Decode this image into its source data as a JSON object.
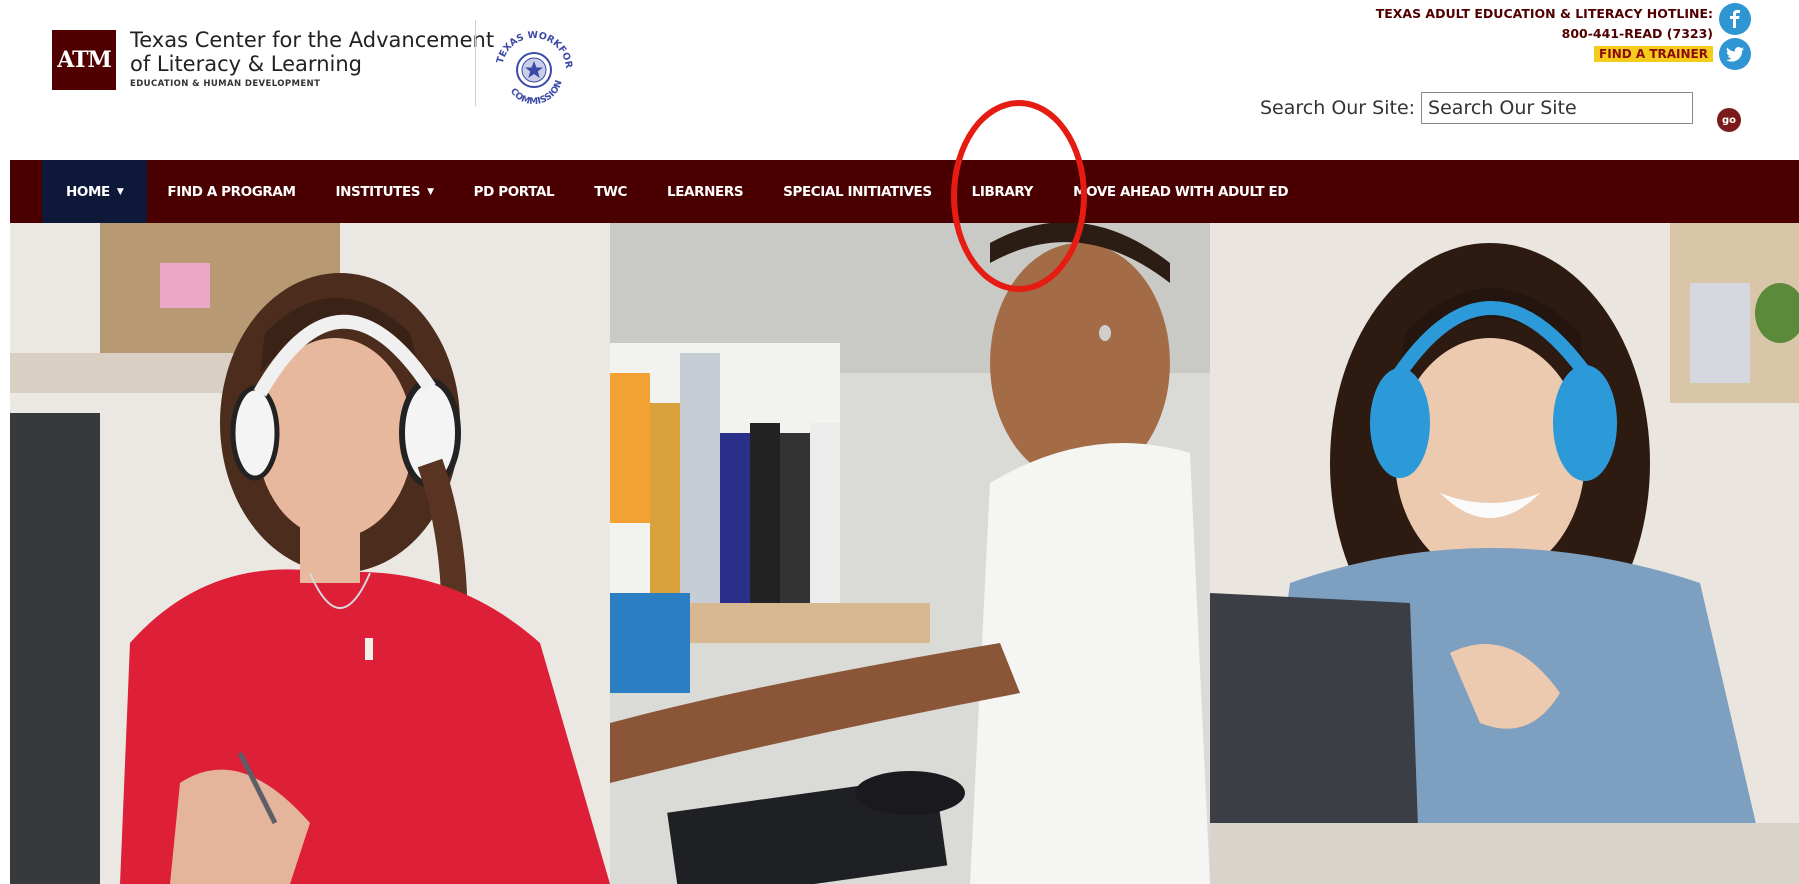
{
  "header": {
    "logo_text": "ATM",
    "brand_line1": "Texas Center for the Advancement",
    "brand_line2": "of Literacy & Learning",
    "brand_sub": "EDUCATION & HUMAN DEVELOPMENT",
    "seal_text": "TEXAS WORKFORCE COMMISSION",
    "hotline_title": "TEXAS ADULT EDUCATION & LITERACY HOTLINE:",
    "hotline_phone": "800-441-READ (7323)",
    "find_trainer": "FIND A TRAINER",
    "social": {
      "facebook_icon": "facebook-icon",
      "twitter_icon": "twitter-icon"
    }
  },
  "search": {
    "label": "Search Our Site:",
    "placeholder": "Search Our Site",
    "go_label": "go"
  },
  "nav": {
    "items": [
      {
        "label": "HOME",
        "has_caret": true,
        "active": true
      },
      {
        "label": "FIND A PROGRAM"
      },
      {
        "label": "INSTITUTES",
        "has_caret": true
      },
      {
        "label": "PD PORTAL"
      },
      {
        "label": "TWC"
      },
      {
        "label": "LEARNERS"
      },
      {
        "label": "SPECIAL INITIATIVES"
      },
      {
        "label": "LIBRARY"
      },
      {
        "label": "MOVE AHEAD WITH ADULT ED"
      }
    ],
    "caret": "▼"
  },
  "colors": {
    "maroon": "#500000",
    "nav_bg": "#4a0000",
    "nav_active": "#0e1838",
    "trainer_bg": "#f4cc1a",
    "social_blue": "#2f95d3",
    "annotation": "#e51c12"
  }
}
